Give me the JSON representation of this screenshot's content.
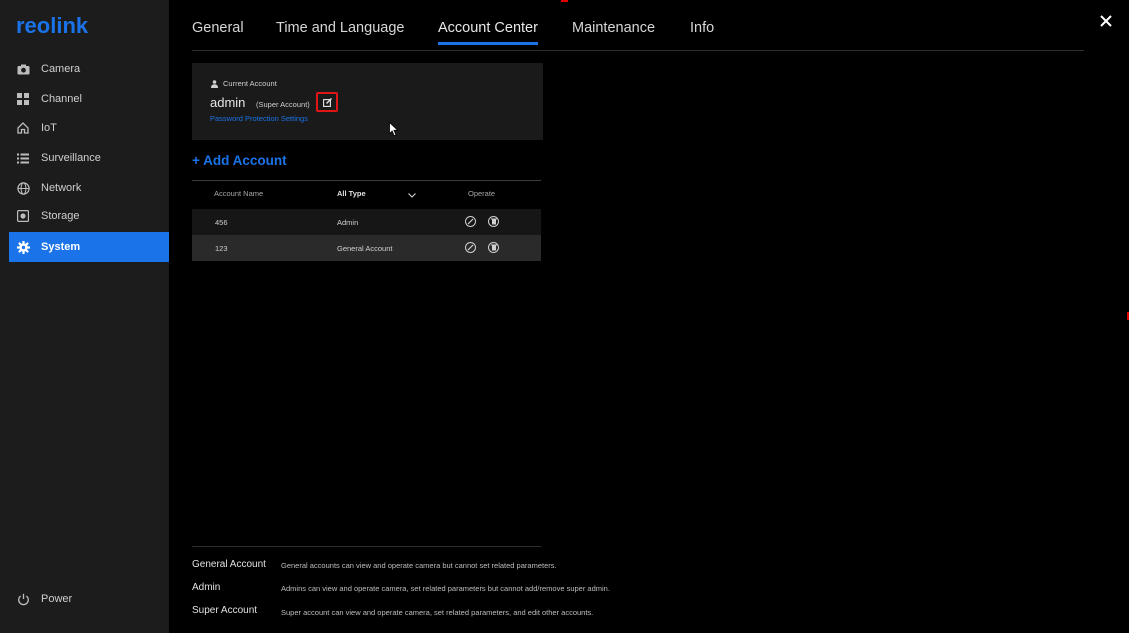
{
  "app": {
    "brand": "reolink"
  },
  "sidebar": {
    "items": [
      {
        "label": "Camera",
        "icon": "camera-icon"
      },
      {
        "label": "Channel",
        "icon": "channel-grid-icon"
      },
      {
        "label": "IoT",
        "icon": "home-icon"
      },
      {
        "label": "Surveillance",
        "icon": "list-icon"
      },
      {
        "label": "Network",
        "icon": "globe-icon"
      },
      {
        "label": "Storage",
        "icon": "storage-icon"
      },
      {
        "label": "System",
        "icon": "gear-icon",
        "active": true
      }
    ],
    "power_label": "Power"
  },
  "tabs": [
    {
      "label": "General"
    },
    {
      "label": "Time and Language"
    },
    {
      "label": "Account Center",
      "active": true
    },
    {
      "label": "Maintenance"
    },
    {
      "label": "Info"
    }
  ],
  "current_account": {
    "heading": "Current Account",
    "name": "admin",
    "type": "(Super Account)",
    "password_link": "Password Protection Settings"
  },
  "add_account_label": "+ Add Account",
  "table": {
    "headers": {
      "name": "Account Name",
      "type": "All Type",
      "operate": "Operate"
    },
    "rows": [
      {
        "name": "456",
        "type": "Admin"
      },
      {
        "name": "123",
        "type": "General Account"
      }
    ]
  },
  "definitions": [
    {
      "term": "General Account",
      "desc": "General accounts can view and operate camera but cannot set related parameters."
    },
    {
      "term": "Admin",
      "desc": "Admins can view and operate camera, set related parameters but cannot add/remove super admin."
    },
    {
      "term": "Super Account",
      "desc": "Super account can view and operate camera, set related parameters, and edit other accounts."
    }
  ],
  "colors": {
    "accent": "#1a73e8",
    "highlight": "#e01515"
  }
}
